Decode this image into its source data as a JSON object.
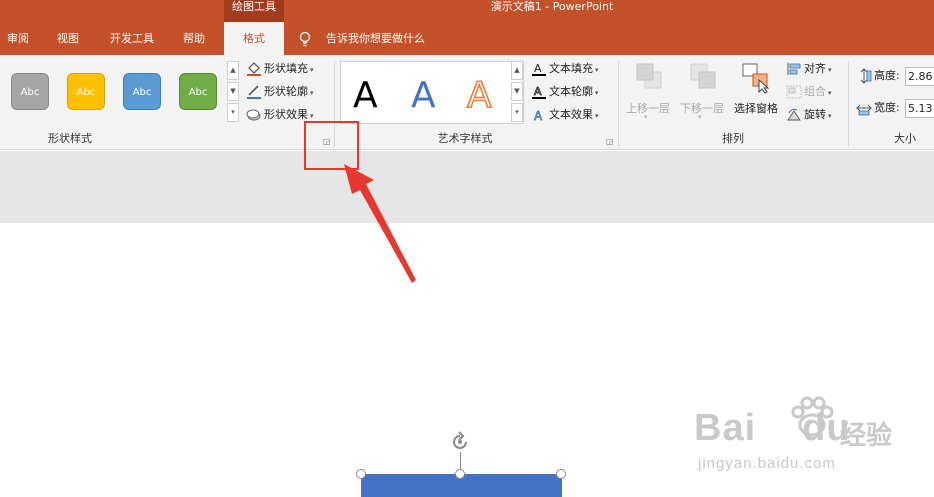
{
  "titlebar": {
    "context_group": "绘图工具",
    "document_title": "演示文稿1  -  PowerPoint"
  },
  "tabs": [
    {
      "label": "审阅",
      "active": false
    },
    {
      "label": "视图",
      "active": false
    },
    {
      "label": "开发工具",
      "active": false
    },
    {
      "label": "帮助",
      "active": false
    },
    {
      "label": "格式",
      "active": true
    }
  ],
  "tell_me": {
    "text": "告诉我你想要做什么",
    "icon": "lightbulb-icon"
  },
  "shape_styles": {
    "label": "形状样式",
    "swatches": [
      {
        "text": "Abc",
        "color": "#a5a5a5"
      },
      {
        "text": "Abc",
        "color": "#ffc000"
      },
      {
        "text": "Abc",
        "color": "#5b9bd5"
      },
      {
        "text": "Abc",
        "color": "#70ad47"
      }
    ],
    "fill_label": "形状填充",
    "outline_label": "形状轮廓",
    "effects_label": "形状效果"
  },
  "wordart_styles": {
    "label": "艺术字样式",
    "letters": [
      {
        "char": "A",
        "color": "#000000"
      },
      {
        "char": "A",
        "color": "#4472c4"
      },
      {
        "char": "A",
        "color": "#ed7d31"
      }
    ],
    "text_fill_label": "文本填充",
    "text_outline_label": "文本轮廓",
    "text_effects_label": "文本效果"
  },
  "arrange": {
    "label": "排列",
    "bring_forward": "上移一层",
    "send_backward": "下移一层",
    "selection_pane": "选择窗格",
    "align": "对齐",
    "group": "组合",
    "rotate": "旋转"
  },
  "size": {
    "label": "大小",
    "height_label": "高度:",
    "height_value": "2.86",
    "width_label": "宽度:",
    "width_value": "5.13"
  },
  "colors": {
    "accent": "#c4512a",
    "shape_fill": "#4472c4",
    "annotation": "#e8372f"
  },
  "watermark": {
    "brand": "Bai",
    "brand2": "du",
    "cn": "经验",
    "url": "jingyan.baidu.com"
  }
}
